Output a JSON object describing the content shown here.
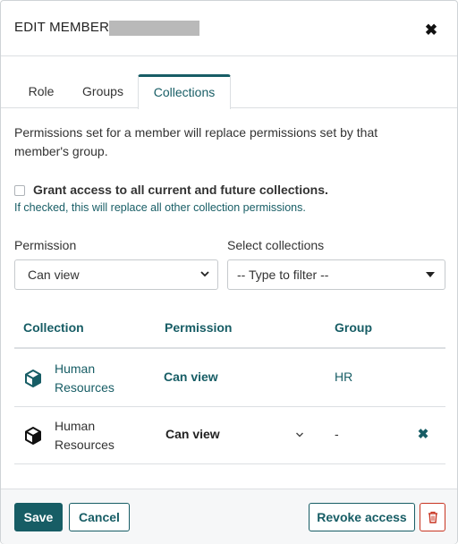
{
  "dialog": {
    "title": "EDIT MEMBER",
    "close_icon": "close-icon"
  },
  "tabs": [
    {
      "label": "Role",
      "active": false
    },
    {
      "label": "Groups",
      "active": false
    },
    {
      "label": "Collections",
      "active": true
    }
  ],
  "collections_tab": {
    "notice": "Permissions set for a member will replace permissions set by that member's group.",
    "grant_all": {
      "checked": false,
      "label": "Grant access to all current and future collections.",
      "hint": "If checked, this will replace all other collection permissions."
    },
    "permission_field": {
      "label": "Permission",
      "value": "Can view"
    },
    "collections_field": {
      "label": "Select collections",
      "placeholder": "-- Type to filter --"
    },
    "table": {
      "headers": [
        "Collection",
        "Permission",
        "Group"
      ],
      "rows": [
        {
          "collection": "Human Resources",
          "permission": "Can view",
          "group": "HR",
          "editable": false,
          "icon": "cube-icon"
        },
        {
          "collection": "Human Resources",
          "permission": "Can view",
          "group": "-",
          "editable": true,
          "icon": "cube-icon"
        }
      ]
    }
  },
  "footer": {
    "save_label": "Save",
    "cancel_label": "Cancel",
    "revoke_label": "Revoke access",
    "delete_icon": "trash-icon"
  },
  "colors": {
    "accent": "#175d65",
    "danger": "#c83522",
    "border": "#dcdfe2"
  }
}
